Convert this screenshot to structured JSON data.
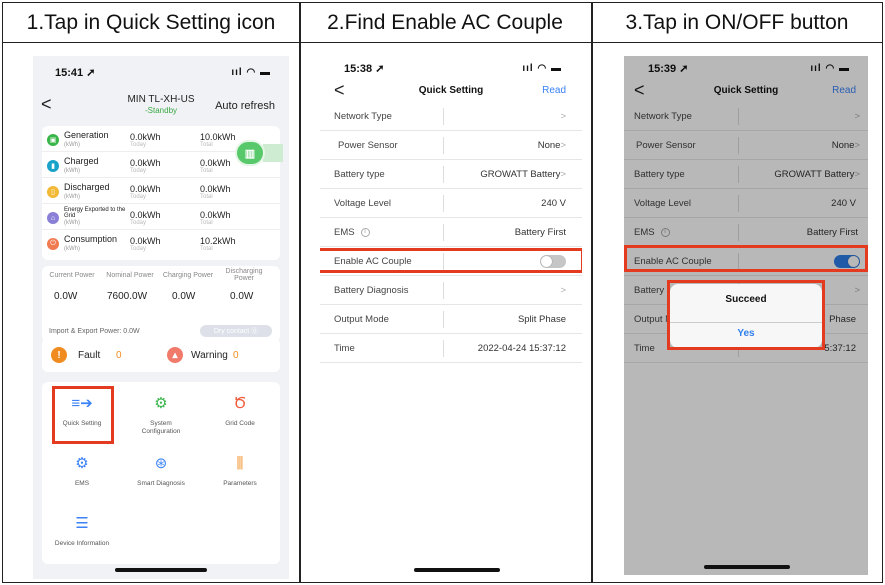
{
  "headers": [
    "1.Tap in Quick Setting icon",
    "2.Find Enable AC Couple",
    "3.Tap in ON/OFF button"
  ],
  "colors": {
    "accent_red": "#e43a1f",
    "toggle_on": "#2f7fe9",
    "toggle_off": "#c6c6c6",
    "green": "#3aa845",
    "orange": "#f08c1f"
  },
  "phone1": {
    "time": "15:41",
    "title": "MIN TL-XH-US",
    "status": "Standby",
    "auto_refresh": "Auto refresh",
    "energy_rows": [
      {
        "label": "Generation",
        "unit": "(kWh)",
        "today": "0.0kWh",
        "total": "10.0kWh",
        "today_label": "Today",
        "total_label": "Total",
        "color": "#3ab54a",
        "icon": "generation-icon"
      },
      {
        "label": "Charged",
        "unit": "(kWh)",
        "today": "0.0kWh",
        "total": "0.0kWh",
        "today_label": "Today",
        "total_label": "Total",
        "color": "#1aa3c9",
        "icon": "charged-icon"
      },
      {
        "label": "Discharged",
        "unit": "(kWh)",
        "today": "0.0kWh",
        "total": "0.0kWh",
        "today_label": "Today",
        "total_label": "Total",
        "color": "#f2b936",
        "icon": "discharged-icon"
      },
      {
        "label": "Energy Exported to the Grid",
        "unit": "(kWh)",
        "today": "0.0kWh",
        "total": "0.0kWh",
        "today_label": "Today",
        "total_label": "Total",
        "color": "#8a7fd6",
        "icon": "grid-export-icon"
      },
      {
        "label": "Consumption",
        "unit": "(kWh)",
        "today": "0.0kWh",
        "total": "10.2kWh",
        "today_label": "Today",
        "total_label": "Total",
        "color": "#f07b51",
        "icon": "consumption-icon"
      }
    ],
    "power": {
      "labels": [
        "Current Power",
        "Nominal Power",
        "Charging Power",
        "Discharging Power"
      ],
      "values": [
        "0.0W",
        "7600.0W",
        "0.0W",
        "0.0W"
      ],
      "import_export": "Import & Export Power: 0.0W",
      "dry_contact": "Dry contact"
    },
    "fault_label": "Fault",
    "fault_count": "0",
    "warning_label": "Warning",
    "warning_count": "0",
    "menu": [
      {
        "label": "Quick Setting",
        "icon": "quick-setting-icon"
      },
      {
        "label": "System Configuration",
        "icon": "system-configuration-icon"
      },
      {
        "label": "Grid Code",
        "icon": "grid-code-icon"
      },
      {
        "label": "EMS",
        "icon": "ems-icon"
      },
      {
        "label": "Smart Diagnosis",
        "icon": "smart-diagnosis-icon"
      },
      {
        "label": "Parameters",
        "icon": "parameters-icon"
      },
      {
        "label": "Device Information",
        "icon": "device-information-icon"
      }
    ]
  },
  "phone2": {
    "time": "15:38",
    "title": "Quick Setting",
    "read": "Read",
    "rows": [
      {
        "label": "Network Type",
        "value": "",
        "chevron": ">"
      },
      {
        "label": "Power Sensor",
        "value": "None",
        "chevron": ">"
      },
      {
        "label": "Battery type",
        "value": "GROWATT Battery",
        "chevron": ">"
      },
      {
        "label": "Voltage Level",
        "value": "240 V",
        "chevron": ""
      },
      {
        "label": "EMS",
        "value": "Battery First",
        "chevron": ""
      },
      {
        "label": "Enable AC Couple",
        "value": "",
        "chevron": ""
      },
      {
        "label": "Battery Diagnosis",
        "value": "",
        "chevron": ">"
      },
      {
        "label": "Output Mode",
        "value": "Split Phase",
        "chevron": ""
      },
      {
        "label": "Time",
        "value": "2022-04-24 15:37:12",
        "chevron": ""
      }
    ],
    "toggle_on": false
  },
  "phone3": {
    "time": "15:39",
    "title": "Quick Setting",
    "read": "Read",
    "rows": [
      {
        "label": "Network Type",
        "value": "",
        "chevron": ">"
      },
      {
        "label": "Power Sensor",
        "value": "None",
        "chevron": ">"
      },
      {
        "label": "Battery type",
        "value": "GROWATT Battery",
        "chevron": ">"
      },
      {
        "label": "Voltage Level",
        "value": "240 V",
        "chevron": ""
      },
      {
        "label": "EMS",
        "value": "Battery First",
        "chevron": ""
      },
      {
        "label": "Enable AC Couple",
        "value": "",
        "chevron": ""
      },
      {
        "label": "Battery I",
        "value": "",
        "chevron": ">"
      },
      {
        "label": "Output M",
        "value": "Phase",
        "chevron": ""
      },
      {
        "label": "Time",
        "value": "5:37:12",
        "chevron": ""
      }
    ],
    "toggle_on": true,
    "dialog_title": "Succeed",
    "dialog_button": "Yes"
  }
}
